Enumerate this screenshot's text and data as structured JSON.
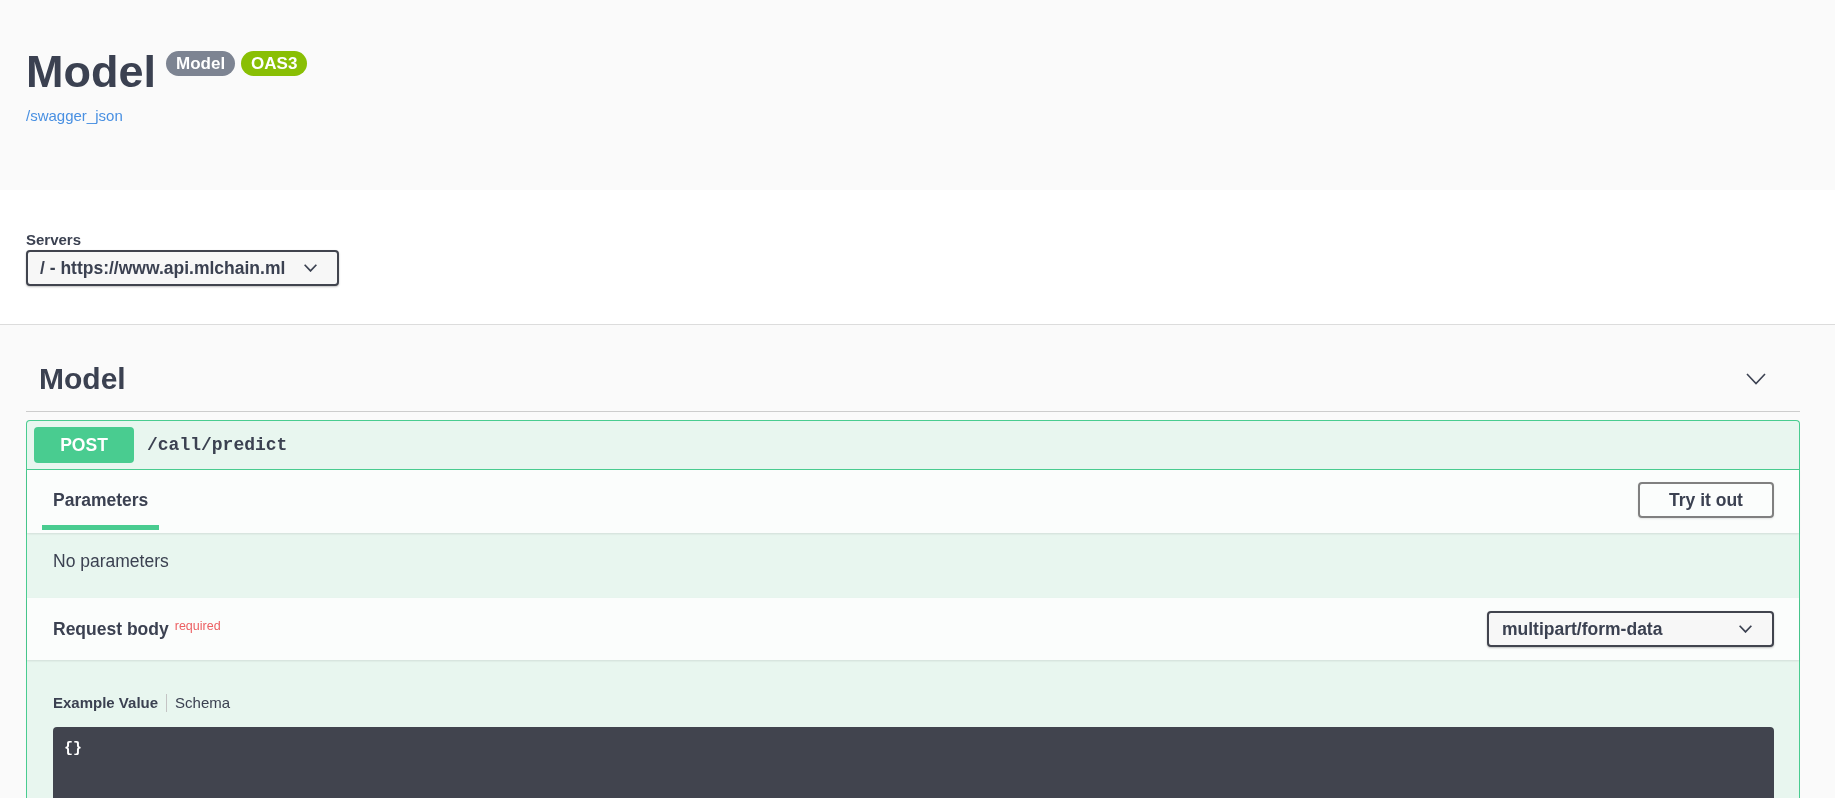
{
  "info": {
    "title": "Model",
    "badges": [
      {
        "label": "Model",
        "color": "#7d8492"
      },
      {
        "label": "OAS3",
        "color": "#89bf04"
      }
    ],
    "link": "/swagger_json"
  },
  "servers": {
    "label": "Servers",
    "value": "/ - https://www.api.mlchain.ml"
  },
  "sections": [
    {
      "title": "Model",
      "expanded": true,
      "operations": [
        {
          "method": "POST",
          "path": "/call/predict",
          "tabs": [
            {
              "label": "Parameters",
              "selected": true
            }
          ],
          "try_button": "Try it out",
          "parameters_note": "No parameters",
          "request_body": {
            "title": "Request body",
            "required_label": "required",
            "content_type": "multipart/form-data",
            "views": [
              {
                "label": "Example Value",
                "selected": true
              },
              {
                "label": "Schema",
                "selected": false
              }
            ],
            "example": "{}"
          }
        }
      ]
    }
  ]
}
